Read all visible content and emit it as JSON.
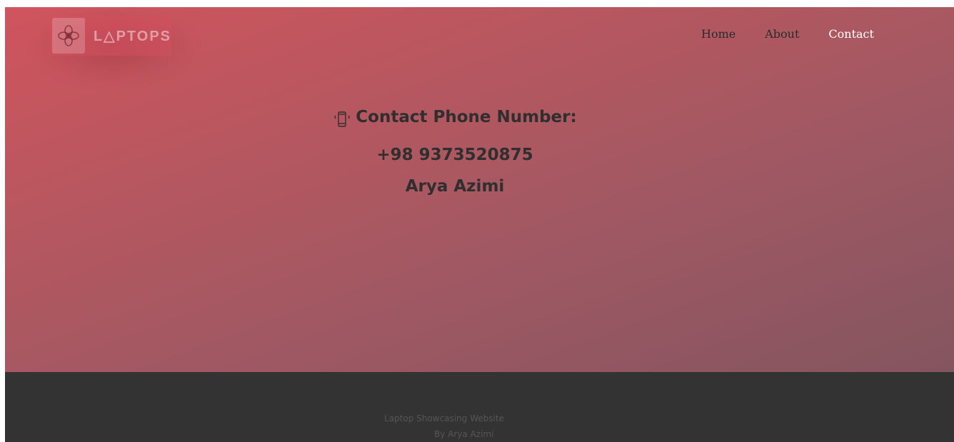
{
  "header": {
    "logo_text": "L△PTOPS",
    "logo_icon": "flower-knot-icon",
    "nav": [
      {
        "label": "Home",
        "active": false
      },
      {
        "label": "About",
        "active": false
      },
      {
        "label": "Contact",
        "active": true
      }
    ]
  },
  "contact": {
    "heading": "Contact Phone Number:",
    "heading_icon": "vibrating-phone-icon",
    "phone": "+98 9373520875",
    "name": "Arya Azimi"
  },
  "footer": {
    "line1": "Laptop Showcasing Website",
    "line2": "By Arya Azimi"
  },
  "colors": {
    "hero_top": "#d0545e",
    "hero_bottom": "#84555f",
    "footer_bg": "#333333",
    "nav_active": "#ffffff",
    "nav_text": "#2b2b2b"
  }
}
